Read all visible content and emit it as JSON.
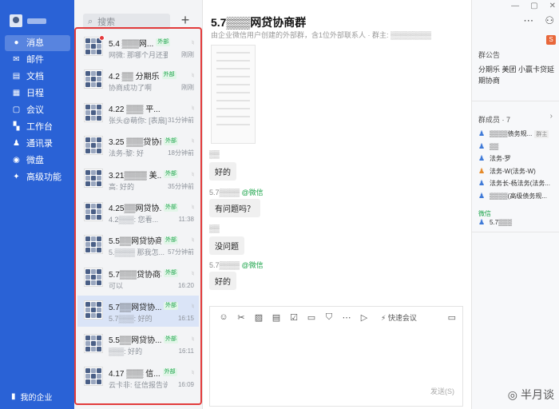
{
  "nav": {
    "items": [
      {
        "label": "消息",
        "icon": "chat-icon",
        "glyph": "●"
      },
      {
        "label": "邮件",
        "icon": "mail-icon",
        "glyph": "✉"
      },
      {
        "label": "文档",
        "icon": "doc-icon",
        "glyph": "▤"
      },
      {
        "label": "日程",
        "icon": "calendar-icon",
        "glyph": "▦"
      },
      {
        "label": "会议",
        "icon": "meeting-icon",
        "glyph": "▢"
      },
      {
        "label": "工作台",
        "icon": "grid-icon",
        "glyph": "▚"
      },
      {
        "label": "通讯录",
        "icon": "contacts-icon",
        "glyph": "♟"
      },
      {
        "label": "微盘",
        "icon": "disk-icon",
        "glyph": "◉"
      },
      {
        "label": "高级功能",
        "icon": "star-icon",
        "glyph": "✦"
      }
    ],
    "bottom_label": "我的企业"
  },
  "search": {
    "placeholder": "搜索"
  },
  "conversations": [
    {
      "title": "5.4 ▒▒▒网...",
      "tag": "外部",
      "preview": "网微: 那哪个月还要还...",
      "time": "刚刚",
      "unread": true,
      "active": false
    },
    {
      "title": "4.2 ▒▒ 分期乐",
      "tag": "外部",
      "preview": "协商成功了啊",
      "time": "刚刚",
      "unread": false,
      "active": false
    },
    {
      "title": "4.22 ▒▒▒ 平...",
      "tag": "",
      "preview": "张头@萌你: [表扇]",
      "time": "31分钟前",
      "unread": false,
      "active": false
    },
    {
      "title": "3.25 ▒▒▒贷协商群",
      "tag": "外部",
      "preview": "法务-黎: 好",
      "time": "18分钟前",
      "unread": false,
      "active": false
    },
    {
      "title": "3.21▒▒▒▒ 美...",
      "tag": "外部",
      "preview": "高: 好的",
      "time": "35分钟前",
      "unread": false,
      "active": false
    },
    {
      "title": "4.25▒▒网贷协...",
      "tag": "外部",
      "preview": "4.2▒▒▒: 您看...",
      "time": "11:38",
      "unread": false,
      "active": false
    },
    {
      "title": "5.5▒▒网贷协商群",
      "tag": "外部",
      "preview": "5.▒▒▒▒ 那我怎...",
      "time": "57分钟前",
      "unread": false,
      "active": false
    },
    {
      "title": "5.7▒▒▒贷协商群",
      "tag": "外部",
      "preview": "可以",
      "time": "16:20",
      "unread": false,
      "active": false
    },
    {
      "title": "5.7▒▒网贷协...",
      "tag": "外部",
      "preview": "5.7▒▒▒: 好的",
      "time": "16:15",
      "unread": false,
      "active": true
    },
    {
      "title": "5.5▒▒网贷协...",
      "tag": "外部",
      "preview": "▒▒▒: 好的",
      "time": "16:11",
      "unread": false,
      "active": false
    },
    {
      "title": "4.17 ▒▒▒ 信...",
      "tag": "外部",
      "preview": "云卡非: 征信报告说...",
      "time": "16:09",
      "unread": false,
      "active": false
    }
  ],
  "chat": {
    "title": "5.7▒▒▒网贷协商群",
    "subtitle": "由企业微信用户创建的外部群，含1位外部联系人 · 群主: ▒▒▒▒▒▒▒▒",
    "messages": [
      {
        "who": "▒▒",
        "wx": "",
        "text": "好的"
      },
      {
        "who": "5.7▒▒▒▒ ",
        "wx": "@微信",
        "text": "有问题吗？"
      },
      {
        "who": "▒▒",
        "wx": "",
        "text": "没问题"
      },
      {
        "who": "5.7▒▒▒▒ ",
        "wx": "@微信",
        "text": "好的"
      }
    ],
    "fast_meeting": "快速会议",
    "send_label": "发送(S)"
  },
  "side": {
    "notice_title": "群公告",
    "notice_text": "分期乐 美团 小赢卡贷延期协商",
    "members_title": "群成员 · 7",
    "members": [
      {
        "name": "▒▒▒▒债务规...",
        "badge": "群主",
        "ext": false
      },
      {
        "name": "▒▒",
        "badge": "",
        "ext": false
      },
      {
        "name": "法务-罗",
        "badge": "",
        "ext": false
      },
      {
        "name": "法务-W(法务-W)",
        "badge": "",
        "ext": true
      },
      {
        "name": "法务长-杨法务(法务...",
        "badge": "",
        "ext": false
      },
      {
        "name": "▒▒▒▒(高级债务规...",
        "badge": "",
        "ext": false
      }
    ],
    "wx_title": "微信",
    "wx_member": "5.7▒▒▒"
  },
  "watermark": "半月谈"
}
